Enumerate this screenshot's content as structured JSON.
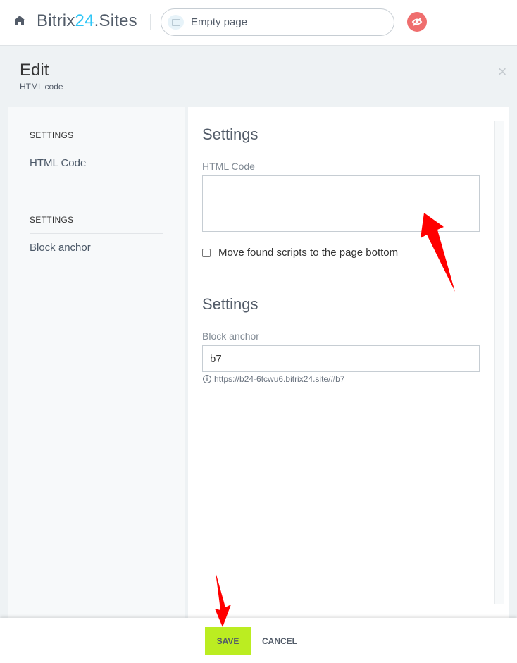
{
  "topbar": {
    "brand_prefix": "Bitrix",
    "brand_number": "24",
    "brand_suffix": ".Sites",
    "page_name": "Empty page",
    "home_icon": "home-icon",
    "preview_icon": "eye-off-icon"
  },
  "header": {
    "title": "Edit",
    "subtitle": "HTML code",
    "close_icon": "close-icon"
  },
  "sidebar": {
    "sections": [
      {
        "heading": "SETTINGS",
        "item": "HTML Code"
      },
      {
        "heading": "SETTINGS",
        "item": "Block anchor"
      }
    ]
  },
  "main": {
    "html_section": {
      "title": "Settings",
      "field_label": "HTML Code",
      "field_value": "",
      "checkbox_label": "Move found scripts to the page bottom",
      "checkbox_checked": false
    },
    "anchor_section": {
      "title": "Settings",
      "field_label": "Block anchor",
      "field_value": "b7",
      "hint": "https://b24-6tcwu6.bitrix24.site/#b7"
    }
  },
  "footer": {
    "save_label": "SAVE",
    "cancel_label": "CANCEL"
  },
  "colors": {
    "accent_brand": "#2fc6f6",
    "save_button": "#bbed21",
    "preview_button": "#ef6e6e",
    "annotation_arrow": "#ff0000"
  }
}
